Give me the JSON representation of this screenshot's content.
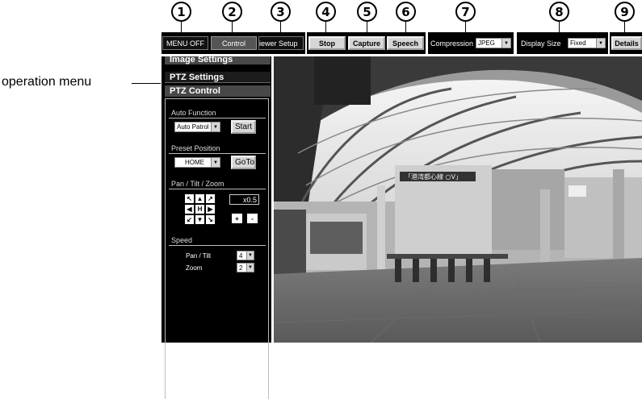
{
  "callouts": [
    "1",
    "2",
    "3",
    "4",
    "5",
    "6",
    "7",
    "8",
    "9"
  ],
  "annotation": {
    "operation_menu": "operation menu"
  },
  "toolbar": {
    "menu_off": "MENU  OFF",
    "control": "Control",
    "viewer_setup": "iewer Setup",
    "stop": "Stop",
    "capture": "Capture",
    "speech": "Speech",
    "compression_label": "Compression",
    "compression_value": "JPEG",
    "display_size_label": "Display Size",
    "display_size_value": "Fixed",
    "details": "Details"
  },
  "panel": {
    "image_settings": "Image Settings",
    "ptz_settings": "PTZ Settings",
    "ptz_control": "PTZ Control",
    "auto_function": {
      "label": "Auto Function",
      "select_value": "Auto Patrol",
      "button": "Start"
    },
    "preset_position": {
      "label": "Preset Position",
      "select_value": "HOME",
      "button": "GoTo"
    },
    "pan_tilt_zoom": {
      "label": "Pan / Tilt / Zoom",
      "zoom_value": "x0.5",
      "home": "H",
      "zoom_in": "+",
      "zoom_out": "-"
    },
    "speed": {
      "label": "Speed",
      "pan_tilt_label": "Pan / Tilt",
      "pan_tilt_value": "4",
      "zoom_label": "Zoom",
      "zoom_value": "2"
    }
  },
  "camera": {
    "sign_text": "「港湾都心線 ○V」"
  },
  "icons": [
    "up-left-arrow-icon",
    "up-arrow-icon",
    "up-right-arrow-icon",
    "left-arrow-icon",
    "right-arrow-icon",
    "down-left-arrow-icon",
    "down-arrow-icon",
    "down-right-arrow-icon",
    "dropdown-arrow-icon"
  ]
}
